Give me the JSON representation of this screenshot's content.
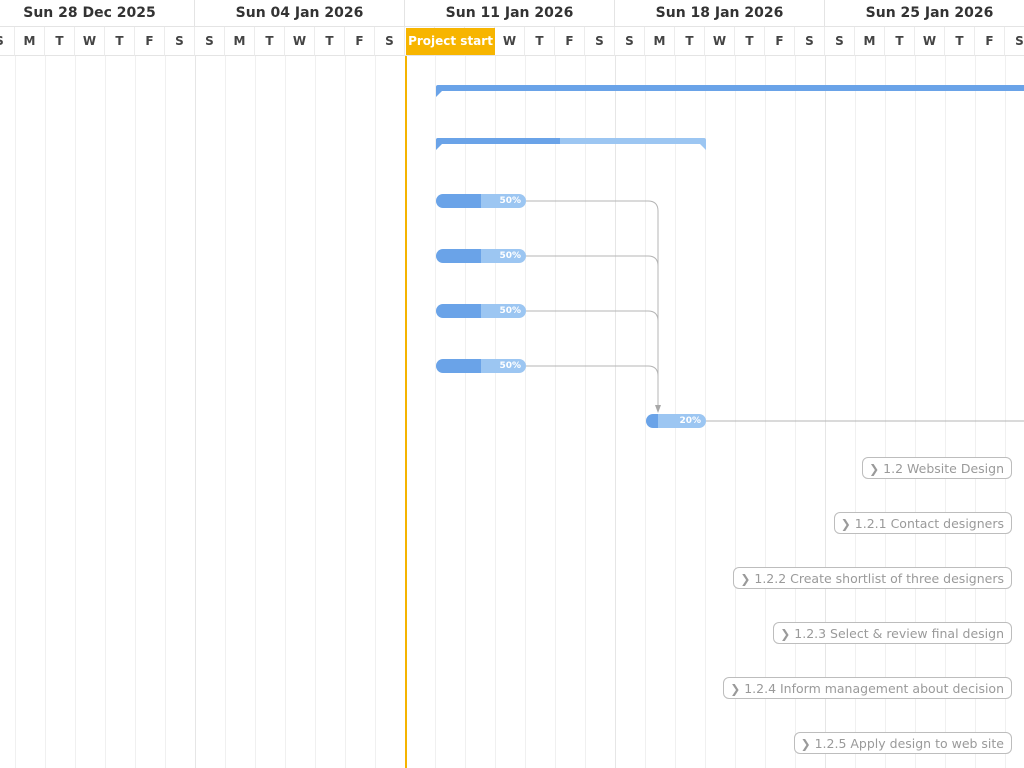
{
  "timeline": {
    "weeks": [
      "Sun 28 Dec 2025",
      "Sun 04 Jan 2026",
      "Sun 11 Jan 2026",
      "Sun 18 Jan 2026",
      "Sun 25 Jan 2026"
    ],
    "days": [
      "S",
      "M",
      "T",
      "W",
      "T",
      "F",
      "S",
      "S",
      "M",
      "T",
      "W",
      "T",
      "F",
      "S",
      "S",
      "M",
      "T",
      "W",
      "T",
      "F",
      "S",
      "S",
      "M",
      "T",
      "W",
      "T",
      "F",
      "S",
      "S",
      "M",
      "T",
      "W",
      "T",
      "F",
      "S",
      "S"
    ]
  },
  "project_start_label": "Project start",
  "colors": {
    "accent": "#f7b500",
    "task_done": "#6aa3e8",
    "task_remaining": "#9cc6f2",
    "link_line": "#b5b5b5"
  },
  "tasks": [
    {
      "id": "t1",
      "kind": "summary",
      "progress": 1.0
    },
    {
      "id": "t2",
      "kind": "summary",
      "progress": 0.46
    },
    {
      "id": "t3",
      "kind": "task",
      "progress": 0.5,
      "percent_label": "50%"
    },
    {
      "id": "t4",
      "kind": "task",
      "progress": 0.5,
      "percent_label": "50%"
    },
    {
      "id": "t5",
      "kind": "task",
      "progress": 0.5,
      "percent_label": "50%"
    },
    {
      "id": "t6",
      "kind": "task",
      "progress": 0.5,
      "percent_label": "50%"
    },
    {
      "id": "t7",
      "kind": "task",
      "progress": 0.2,
      "percent_label": "20%"
    }
  ],
  "collapsed_labels": [
    "1.2 Website Design",
    "1.2.1 Contact designers",
    "1.2.2 Create shortlist of three designers",
    "1.2.3 Select & review final design",
    "1.2.4 Inform management about decision",
    "1.2.5 Apply design to web site"
  ],
  "icons": {
    "label_chevron": "chevron-right-icon"
  }
}
